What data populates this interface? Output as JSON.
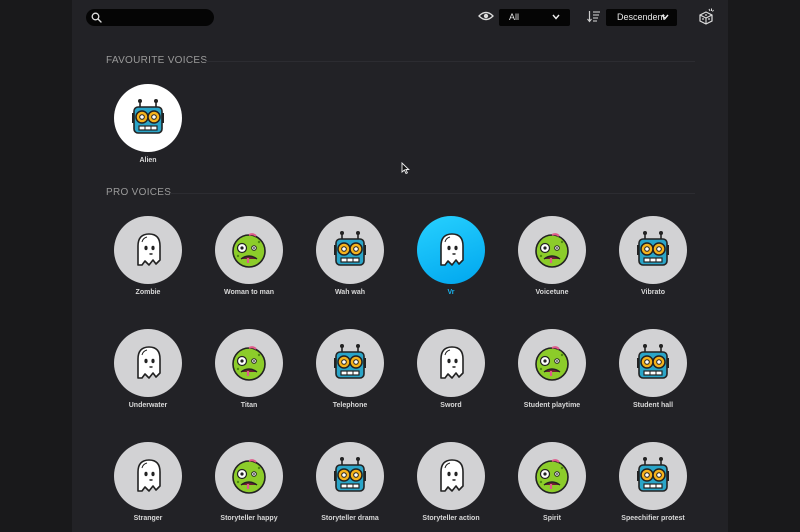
{
  "toolbar": {
    "search_placeholder": "",
    "filter_selected": "All",
    "sort_selected": "Descendent"
  },
  "sections": {
    "favourites_title": "FAVOURITE VOICES",
    "pro_title": "PRO VOICES"
  },
  "favourites": [
    {
      "name": "Alien",
      "icon": "robot"
    }
  ],
  "pro_voices": [
    {
      "name": "Zombie",
      "icon": "ghost"
    },
    {
      "name": "Woman to man",
      "icon": "zombie"
    },
    {
      "name": "Wah wah",
      "icon": "robot"
    },
    {
      "name": "Vr",
      "icon": "ghost",
      "selected": true
    },
    {
      "name": "Voicetune",
      "icon": "zombie"
    },
    {
      "name": "Vibrato",
      "icon": "robot"
    },
    {
      "name": "Underwater",
      "icon": "ghost"
    },
    {
      "name": "Titan",
      "icon": "zombie"
    },
    {
      "name": "Telephone",
      "icon": "robot"
    },
    {
      "name": "Sword",
      "icon": "ghost"
    },
    {
      "name": "Student playtime",
      "icon": "zombie"
    },
    {
      "name": "Student hall",
      "icon": "robot"
    },
    {
      "name": "Stranger",
      "icon": "ghost"
    },
    {
      "name": "Storyteller happy",
      "icon": "zombie"
    },
    {
      "name": "Storyteller drama",
      "icon": "robot"
    },
    {
      "name": "Storyteller action",
      "icon": "ghost"
    },
    {
      "name": "Spirit",
      "icon": "zombie"
    },
    {
      "name": "Speechifier protest",
      "icon": "robot"
    }
  ],
  "colors": {
    "accent": "#1ab6f0",
    "robot_body": "#2aa5c8",
    "robot_gear": "#f5b21c",
    "zombie_skin": "#8ccc2a"
  }
}
